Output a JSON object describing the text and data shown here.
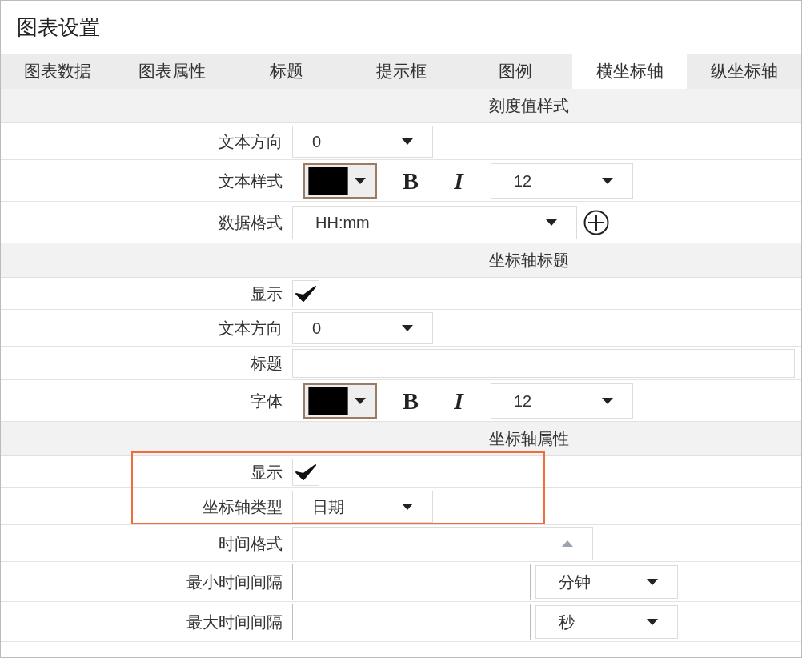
{
  "window": {
    "title": "图表设置"
  },
  "tabs": [
    {
      "label": "图表数据",
      "selected": false
    },
    {
      "label": "图表属性",
      "selected": false
    },
    {
      "label": "标题",
      "selected": false
    },
    {
      "label": "提示框",
      "selected": false
    },
    {
      "label": "图例",
      "selected": false
    },
    {
      "label": "横坐标轴",
      "selected": true
    },
    {
      "label": "纵坐标轴",
      "selected": false
    }
  ],
  "sections": [
    {
      "title": "刻度值样式",
      "rows": [
        {
          "kind": "select",
          "label": "文本方向",
          "value": "0",
          "highlighted": false
        },
        {
          "kind": "style",
          "label": "文本样式",
          "color": "#000000",
          "bold": "B",
          "italic": "I",
          "size": "12",
          "highlighted": false
        },
        {
          "kind": "format",
          "label": "数据格式",
          "value": "HH:mm",
          "highlighted": false
        }
      ]
    },
    {
      "title": "坐标轴标题",
      "rows": [
        {
          "kind": "checkbox",
          "label": "显示",
          "checked": true,
          "highlighted": false
        },
        {
          "kind": "select",
          "label": "文本方向",
          "value": "0",
          "highlighted": false
        },
        {
          "kind": "text",
          "label": "标题",
          "highlighted": false
        },
        {
          "kind": "style",
          "label": "字体",
          "color": "#000000",
          "bold": "B",
          "italic": "I",
          "size": "12",
          "highlighted": false
        }
      ]
    },
    {
      "title": "坐标轴属性",
      "rows": [
        {
          "kind": "checkbox",
          "label": "显示",
          "checked": true,
          "highlighted": true
        },
        {
          "kind": "select",
          "label": "坐标轴类型",
          "value": "日期",
          "highlighted": true
        },
        {
          "kind": "timeformat",
          "label": "时间格式",
          "highlighted": false
        },
        {
          "kind": "interval",
          "label": "最小时间间隔",
          "unit": "分钟",
          "highlighted": false
        },
        {
          "kind": "interval",
          "label": "最大时间间隔",
          "unit": "秒",
          "highlighted": false
        }
      ]
    }
  ]
}
